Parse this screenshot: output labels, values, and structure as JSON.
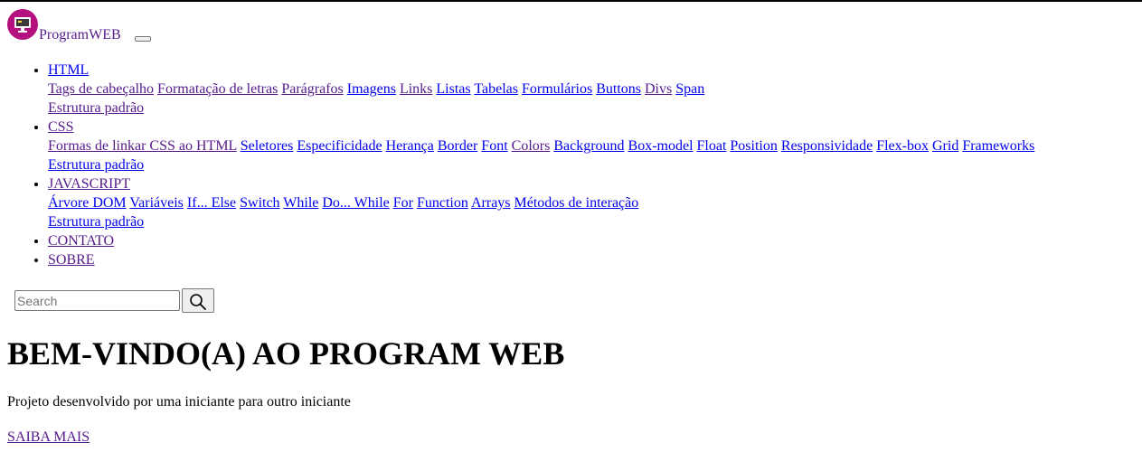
{
  "brand": {
    "name": " ProgramWEB ",
    "logo_icon": "monitor-icon",
    "logo_color": "#b5117e"
  },
  "nav": {
    "html": {
      "label": "HTML",
      "items": [
        "Tags de cabeçalho",
        "Formatação de letras",
        "Parágrafos",
        "Imagens",
        "Links",
        "Listas",
        "Tabelas",
        "Formulários",
        "Buttons",
        "Divs",
        "Span"
      ],
      "extra": "Estrutura padrão"
    },
    "css": {
      "label": "CSS",
      "items": [
        "Formas de linkar CSS ao HTML",
        "Seletores",
        "Especificidade",
        "Herança",
        "Border",
        "Font",
        "Colors",
        "Background",
        "Box-model",
        "Float",
        "Position",
        "Responsividade",
        "Flex-box",
        "Grid",
        "Frameworks"
      ],
      "extra": "Estrutura padrão"
    },
    "js": {
      "label": "JAVASCRIPT",
      "items": [
        "Árvore DOM",
        "Variáveis",
        "If... Else",
        "Switch",
        "While",
        "Do... While",
        "For",
        "Function",
        "Arrays",
        "Métodos de interação"
      ],
      "extra": "Estrutura padrão"
    },
    "contato": "CONTATO",
    "sobre": "SOBRE"
  },
  "search": {
    "placeholder": "Search",
    "button_icon": "search-icon"
  },
  "hero": {
    "title": "BEM-VINDO(A) AO PROGRAM WEB",
    "subtitle": "Projeto desenvolvido por uma iniciante para outro iniciante",
    "cta": "SAIBA MAIS"
  },
  "colors": {
    "link": "#0000ee",
    "visited": "#551a8b"
  }
}
